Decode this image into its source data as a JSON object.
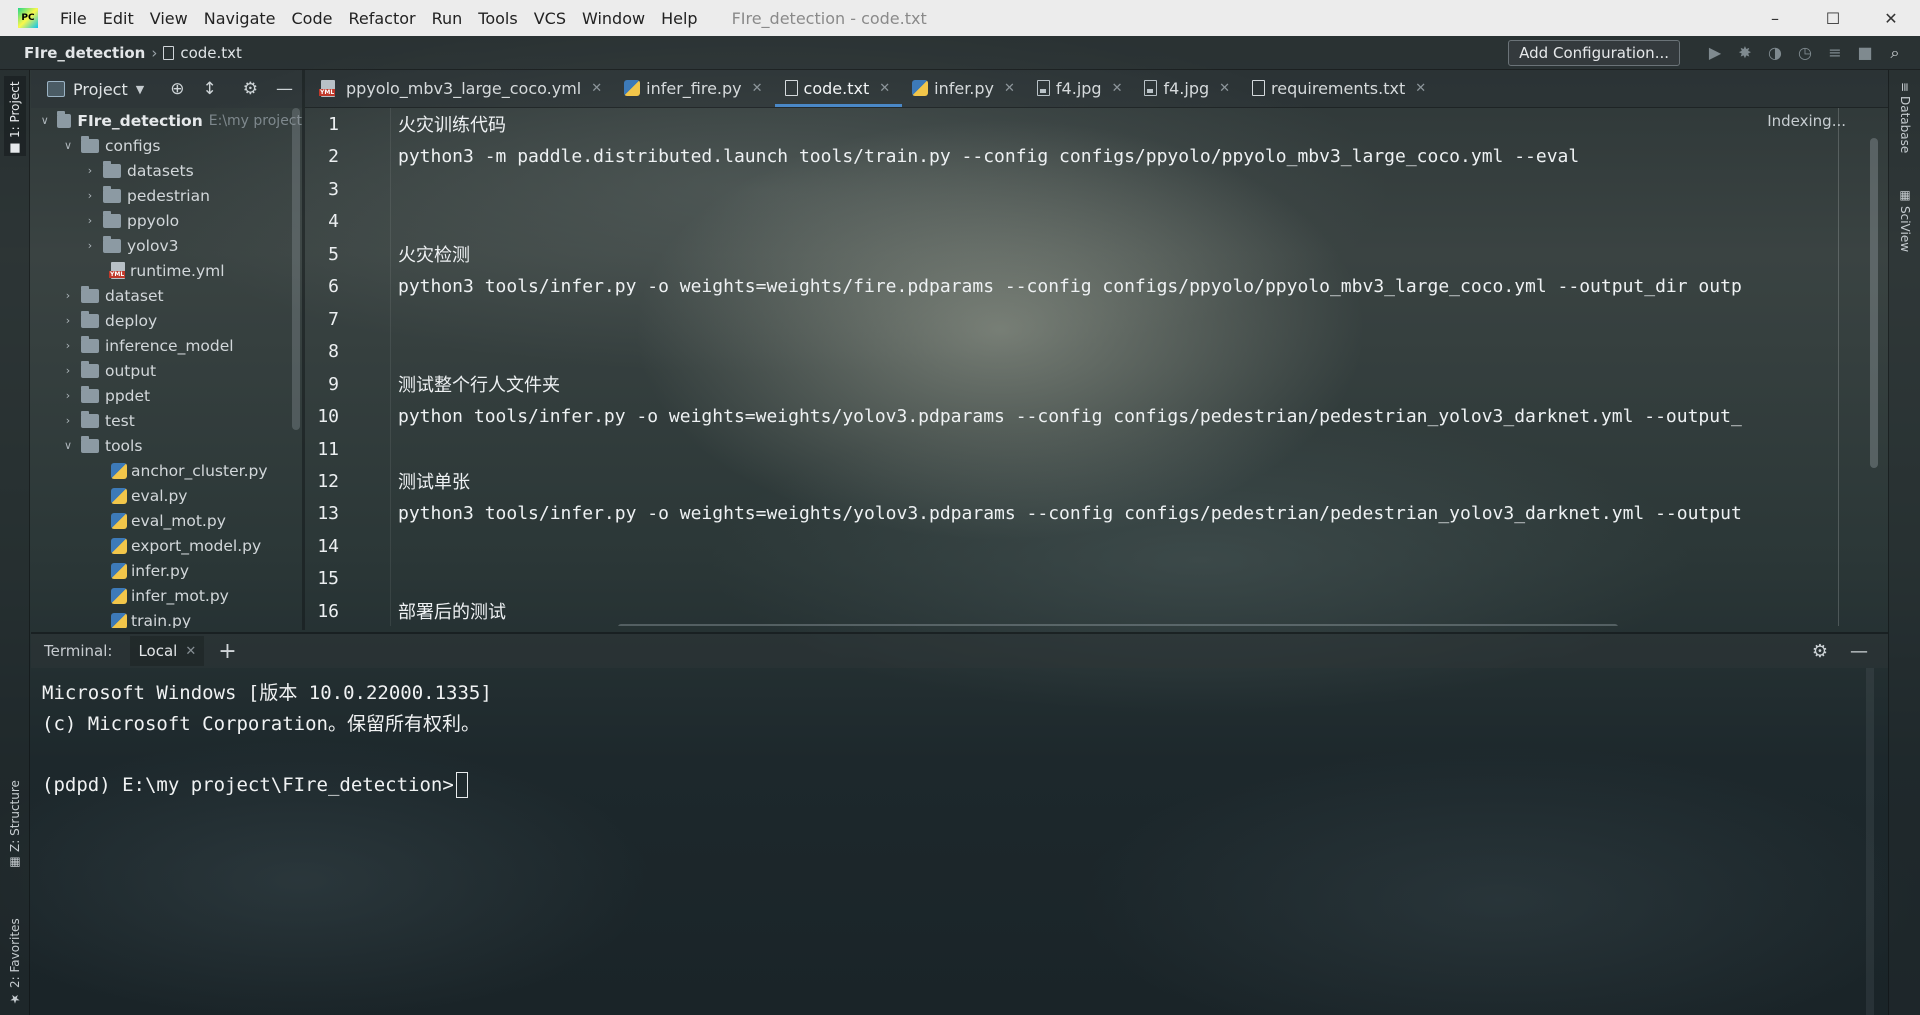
{
  "menubar": {
    "items": [
      {
        "label": "File"
      },
      {
        "label": "Edit"
      },
      {
        "label": "View"
      },
      {
        "label": "Navigate"
      },
      {
        "label": "Code"
      },
      {
        "label": "Refactor"
      },
      {
        "label": "Run"
      },
      {
        "label": "Tools"
      },
      {
        "label": "VCS"
      },
      {
        "label": "Window"
      },
      {
        "label": "Help"
      }
    ],
    "window_title": "FIre_detection - code.txt"
  },
  "navbar": {
    "project": "FIre_detection",
    "file": "code.txt",
    "add_config": "Add Configuration..."
  },
  "left_tool_tabs": {
    "project": "1: Project",
    "structure": "Z: Structure",
    "favorites": "2: Favorites"
  },
  "right_tool_tabs": {
    "database": "Database",
    "sciview": "SciView"
  },
  "project_panel": {
    "title": "Project",
    "tree": [
      {
        "name": "FIre_detection",
        "hint": "E:\\my project",
        "type": "root"
      },
      {
        "name": "configs",
        "type": "folder-open"
      },
      {
        "name": "datasets",
        "type": "folder"
      },
      {
        "name": "pedestrian",
        "type": "folder"
      },
      {
        "name": "ppyolo",
        "type": "folder"
      },
      {
        "name": "yolov3",
        "type": "folder"
      },
      {
        "name": "runtime.yml",
        "type": "yml"
      },
      {
        "name": "dataset",
        "type": "folder"
      },
      {
        "name": "deploy",
        "type": "folder"
      },
      {
        "name": "inference_model",
        "type": "folder"
      },
      {
        "name": "output",
        "type": "folder"
      },
      {
        "name": "ppdet",
        "type": "folder"
      },
      {
        "name": "test",
        "type": "folder"
      },
      {
        "name": "tools",
        "type": "folder-open"
      },
      {
        "name": "anchor_cluster.py",
        "type": "py"
      },
      {
        "name": "eval.py",
        "type": "py"
      },
      {
        "name": "eval_mot.py",
        "type": "py"
      },
      {
        "name": "export_model.py",
        "type": "py"
      },
      {
        "name": "infer.py",
        "type": "py"
      },
      {
        "name": "infer_mot.py",
        "type": "py"
      },
      {
        "name": "train.py",
        "type": "py"
      }
    ]
  },
  "tabs": [
    {
      "label": "ppyolo_mbv3_large_coco.yml",
      "icon": "yml-icon",
      "active": false
    },
    {
      "label": "infer_fire.py",
      "icon": "python-icon",
      "active": false
    },
    {
      "label": "code.txt",
      "icon": "text-file-icon",
      "active": true
    },
    {
      "label": "infer.py",
      "icon": "python-icon",
      "active": false
    },
    {
      "label": "f4.jpg",
      "icon": "image-icon",
      "active": false
    },
    {
      "label": "f4.jpg",
      "icon": "image-icon",
      "active": false
    },
    {
      "label": "requirements.txt",
      "icon": "text-file-icon",
      "active": false
    }
  ],
  "editor": {
    "status": "Indexing...",
    "lines": [
      {
        "n": "1",
        "text": "火灾训练代码"
      },
      {
        "n": "2",
        "text": "python3 -m paddle.distributed.launch tools/train.py --config configs/ppyolo/ppyolo_mbv3_large_coco.yml --eval"
      },
      {
        "n": "3",
        "text": ""
      },
      {
        "n": "4",
        "text": ""
      },
      {
        "n": "5",
        "text": "火灾检测"
      },
      {
        "n": "6",
        "text": "python3 tools/infer.py -o weights=weights/fire.pdparams --config configs/ppyolo/ppyolo_mbv3_large_coco.yml --output_dir outp"
      },
      {
        "n": "7",
        "text": ""
      },
      {
        "n": "8",
        "text": ""
      },
      {
        "n": "9",
        "text": "测试整个行人文件夹"
      },
      {
        "n": "10",
        "text": "python tools/infer.py -o weights=weights/yolov3.pdparams --config configs/pedestrian/pedestrian_yolov3_darknet.yml --output_"
      },
      {
        "n": "11",
        "text": ""
      },
      {
        "n": "12",
        "text": "测试单张"
      },
      {
        "n": "13",
        "text": "python3 tools/infer.py -o weights=weights/yolov3.pdparams --config configs/pedestrian/pedestrian_yolov3_darknet.yml --output"
      },
      {
        "n": "14",
        "text": ""
      },
      {
        "n": "15",
        "text": ""
      },
      {
        "n": "16",
        "text": "部署后的测试"
      }
    ]
  },
  "terminal": {
    "label": "Terminal:",
    "tab": "Local",
    "lines": [
      "Microsoft Windows [版本 10.0.22000.1335]",
      "(c) Microsoft Corporation。保留所有权利。",
      "",
      "(pdpd) E:\\my project\\FIre_detection>"
    ]
  }
}
